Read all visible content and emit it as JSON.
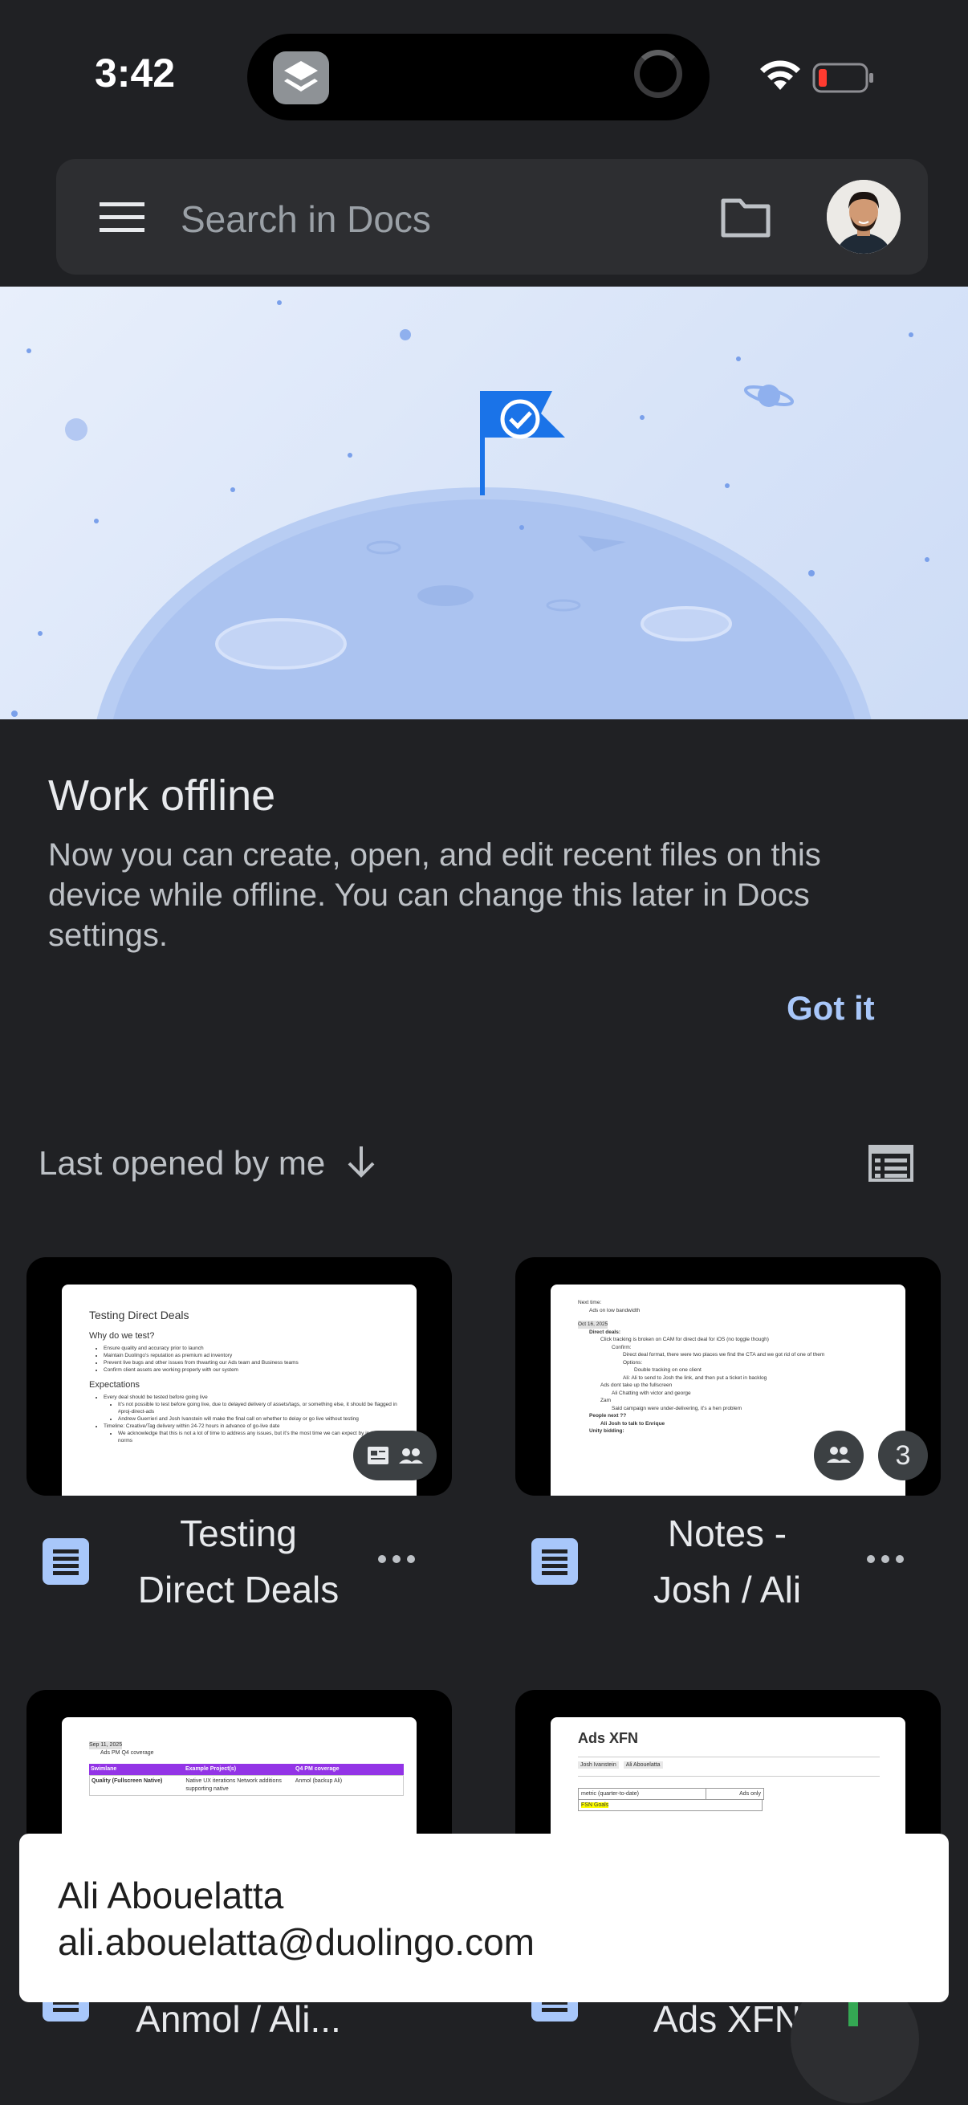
{
  "status_bar": {
    "time": "3:42"
  },
  "search": {
    "placeholder": "Search in Docs"
  },
  "offline_card": {
    "title": "Work offline",
    "body": "Now you can create, open, and edit recent files on this device while offline. You can change this later in Docs settings.",
    "action": "Got it"
  },
  "sort": {
    "label": "Last opened by me"
  },
  "documents": [
    {
      "title_line1": "Testing",
      "title_line2": "Direct Deals",
      "preview": {
        "heading": "Testing Direct Deals",
        "section1": "Why do we test?",
        "bullets1": [
          "Ensure quality and accuracy prior to launch",
          "Maintain Duolingo's reputation as premium ad inventory",
          "Prevent live bugs and other issues from thwarting our Ads team and Business teams",
          "Confirm client assets are working properly with our system"
        ],
        "section2": "Expectations",
        "bullets2": [
          "Every deal should be tested before going live",
          "It's not possible to test before going live, due to delayed delivery of assets/tags, or something else, it should be flagged in #proj-direct-ads",
          "Andrew Guerrieri and Josh Ivanstein will make the final call on whether to delay or go live without testing",
          "Timeline: Creative/Tag delivery within 24-72 hours in advance of go-live date",
          "We acknowledge that this is not a lot of time to address any issues, but it's the most time we can expect by industry norms"
        ]
      }
    },
    {
      "title_line1": "Notes -",
      "title_line2": "Josh / Ali",
      "badge_count": "3",
      "preview": {
        "lines": [
          "Next time:",
          "Ads on low bandwidth",
          "Oct 16, 2025",
          "Direct deals:",
          "Click tracking is broken on CAM for direct deal for iOS (no toggle though)",
          "Confirm:",
          "Direct deal format, there were two places we find the CTA and we got rid of one of them",
          "Options:",
          "Double tracking on one client",
          "Ali: Ali to send to Josh the link, and then put a ticket in backlog",
          "Ads dont take up the fullscreen",
          "Ali Chatting with victor and george",
          "Zam",
          "Said campaign were under-delivering, it's a hen problem",
          "People next ??",
          "Ali Josh to talk to Enrique",
          "Unity bidding:"
        ]
      }
    },
    {
      "title_line1": "Anmol / Ali...",
      "preview": {
        "date": "Sep 11, 2025",
        "bullet": "Ads PM Q4 coverage",
        "table_headers": [
          "Swimlane",
          "Example Project(s)",
          "Q4 PM coverage"
        ],
        "table_row": [
          "Quality (Fullscreen Native)",
          "Native UX iterations Network additions supporting native",
          "Anmol (backup Ali)"
        ]
      }
    },
    {
      "title_line1": "Ads XFN",
      "preview": {
        "heading": "Ads XFN",
        "chips": [
          "Josh Ivanstein",
          "Ali Abouelatta"
        ],
        "table_headers": [
          "metric (quarter-to-date)",
          "Ads only"
        ],
        "highlight": "FSN Goals"
      }
    }
  ],
  "account_toast": {
    "name": "Ali Abouelatta",
    "email": "ali.abouelatta@duolingo.com"
  },
  "colors": {
    "background": "#202124",
    "accent": "#a8c7fa",
    "doc_icon": "#a8c7fa"
  }
}
